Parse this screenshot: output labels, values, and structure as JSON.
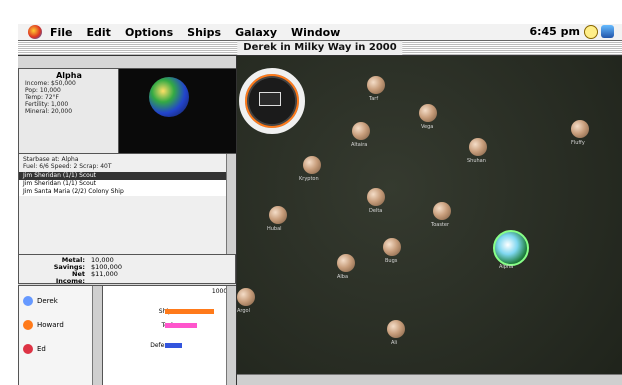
{
  "menubar": {
    "items": [
      "File",
      "Edit",
      "Options",
      "Ships",
      "Galaxy",
      "Window"
    ],
    "clock": "6:45 pm"
  },
  "window": {
    "title": "Derek in Milky Way in 2000"
  },
  "planet_info": {
    "name": "Alpha",
    "lines": [
      "Income: $50,000",
      "Pop: 10,000",
      "Temp: 72°F",
      "Fertility: 1,000",
      "Mineral: 20,000"
    ]
  },
  "ship_panel": {
    "header": [
      "Starbase at: Alpha",
      "Fuel: 6/6    Speed: 2    Scrap: 40T"
    ],
    "rows": [
      {
        "text": "Jim Sheridan  (1/1)  Scout",
        "selected": true
      },
      {
        "text": "Jim Sheridan  (1/1)  Scout",
        "selected": false
      },
      {
        "text": "Jim Santa Maria (2/2)  Colony Ship",
        "selected": false
      }
    ]
  },
  "bank": {
    "rows": [
      {
        "label": "Metal:",
        "value": "10,000"
      },
      {
        "label": "Savings:",
        "value": "$100,000"
      },
      {
        "label": "Net Income:",
        "value": "$11,000"
      }
    ]
  },
  "players": [
    {
      "name": "Derek",
      "color": "#6699ff"
    },
    {
      "name": "Howard",
      "color": "#ff7a1a"
    },
    {
      "name": "Ed",
      "color": "#dd3344"
    }
  ],
  "graph": {
    "title": "10000",
    "bars": [
      {
        "label": "Ships",
        "value": 0.85,
        "color": "#ff7a1a"
      },
      {
        "label": "Tech",
        "value": 0.55,
        "color": "#ff55cc"
      },
      {
        "label": "Defense",
        "value": 0.3,
        "color": "#3355dd"
      }
    ]
  },
  "map": {
    "stars": [
      {
        "name": "Tarf"
      },
      {
        "name": "Vega"
      },
      {
        "name": "Altaira"
      },
      {
        "name": "Shuhan"
      },
      {
        "name": "Fluffy"
      },
      {
        "name": "Krypton"
      },
      {
        "name": "Delta"
      },
      {
        "name": "Toaster"
      },
      {
        "name": "Hubal"
      },
      {
        "name": "Bugs"
      },
      {
        "name": "Alba"
      },
      {
        "name": "Argol"
      },
      {
        "name": "Ali"
      }
    ],
    "home": {
      "name": "Alpha"
    }
  }
}
